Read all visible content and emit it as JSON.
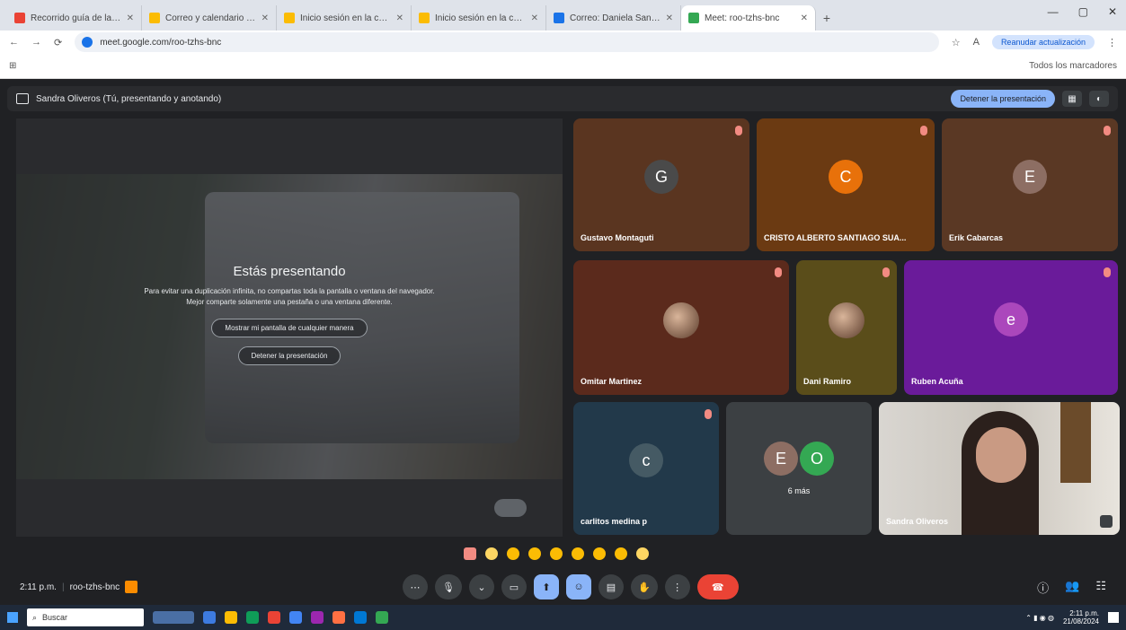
{
  "browser": {
    "tabs": [
      {
        "title": "Recorrido guía de la planifica",
        "color": "#ea4335"
      },
      {
        "title": "Correo y calendario personal",
        "color": "#fbbc04"
      },
      {
        "title": "Inicio sesión en la cuenta",
        "color": "#fbbc04"
      },
      {
        "title": "Inicio sesión en la cuenta",
        "color": "#fbbc04"
      },
      {
        "title": "Correo: Daniela Sandi Oliveros",
        "color": "#1a73e8"
      },
      {
        "title": "Meet: roo-tzhs-bnc",
        "color": "#34a853",
        "active": true
      }
    ],
    "url": "meet.google.com/roo-tzhs-bnc",
    "profile_label": "Reanudar actualización",
    "bookmarks_right": "Todos los marcadores",
    "window_controls": [
      "—",
      "▢",
      "✕"
    ]
  },
  "meet": {
    "presenter_bar": "Sandra Oliveros (Tú, presentando y anotando)",
    "stop_presenting_button": "Detener la presentación",
    "presenting_title": "Estás presentando",
    "presenting_message": "Para evitar una duplicación infinita, no compartas toda la pantalla o ventana del navegador. Mejor comparte solamente una pestaña o una ventana diferente.",
    "show_anyway_button": "Mostrar mi pantalla de cualquier manera",
    "stop_button": "Detener la presentación",
    "participants": [
      {
        "initial": "G",
        "name": "Gustavo Montaguti",
        "bg": "#5a3520",
        "avatar_bg": "#4a4a4a"
      },
      {
        "initial": "C",
        "name": "CRISTO ALBERTO SANTIAGO SUA...",
        "bg": "#6b3a12",
        "avatar_bg": "#e8710a"
      },
      {
        "initial": "E",
        "name": "Erik Cabarcas",
        "bg": "#5a3824",
        "avatar_bg": "#8d6e63"
      },
      {
        "initial": "",
        "name": "Omitar Martinez",
        "bg": "#5b2a1c",
        "photo": true
      },
      {
        "initial": "",
        "name": "Dani Ramiro",
        "bg": "#5a4d1a",
        "photo": true
      },
      {
        "initial": "e",
        "name": "Ruben Acuña",
        "bg": "#6a1b9a",
        "avatar_bg": "#ab47bc"
      },
      {
        "initial": "c",
        "name": "carlitos medina p",
        "bg": "#22394a",
        "avatar_bg": "#455a64"
      }
    ],
    "more_tile": {
      "initials": [
        "E",
        "O"
      ],
      "colors": [
        "#8d6e63",
        "#34a853"
      ],
      "label": "6 más"
    },
    "self_tile_name": "Sandra Oliveros",
    "time": "2:11 p.m.",
    "meeting_code": "roo-tzhs-bnc",
    "control_icons": [
      "⋯",
      "🎙",
      "⌄",
      "▭",
      "⬆",
      "☺",
      "▤",
      "✋",
      "⋮",
      "☎"
    ],
    "right_icons": [
      "ⓘ",
      "👥",
      "☷"
    ]
  },
  "taskbar": {
    "search_placeholder": "Buscar",
    "time": "2:11 p.m.",
    "date": "21/08/2024"
  }
}
